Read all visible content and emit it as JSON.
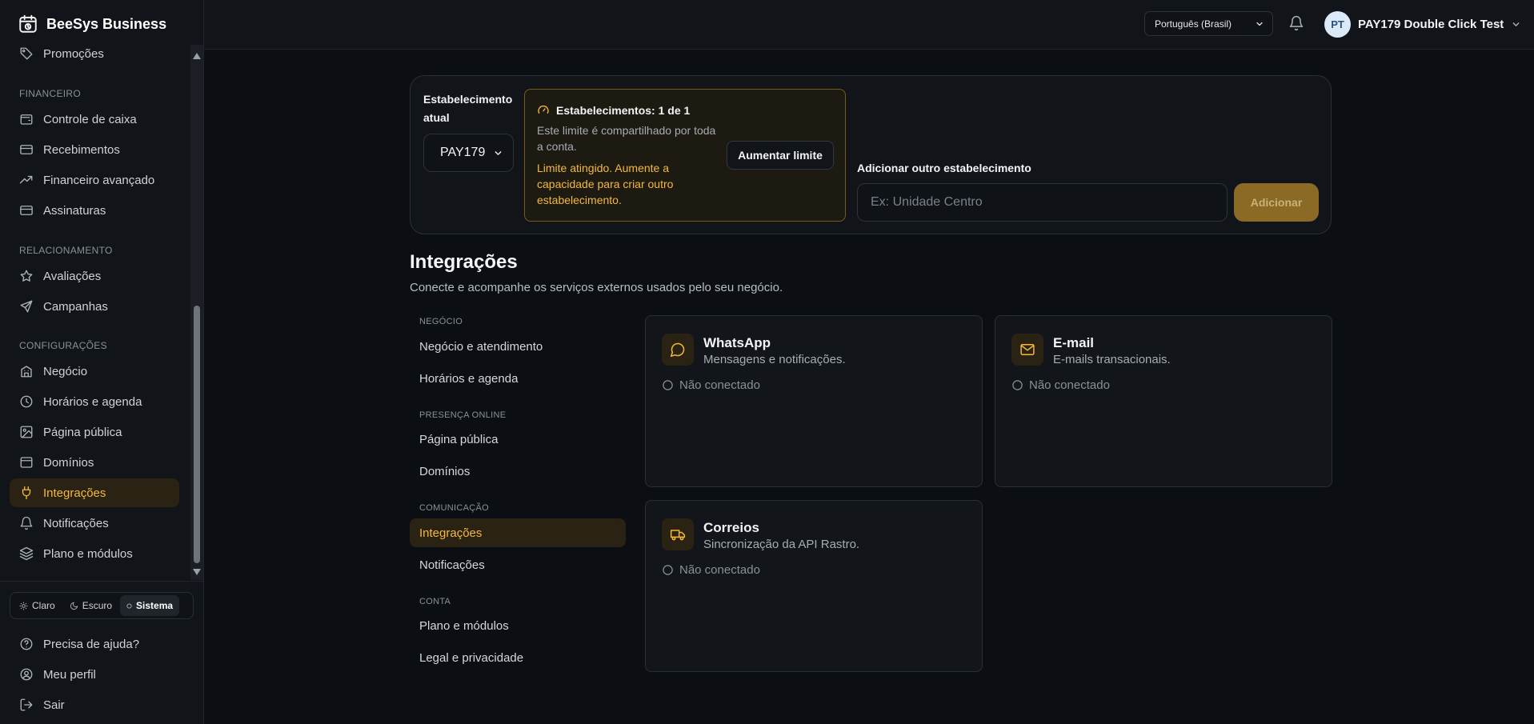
{
  "app": {
    "name": "BeeSys Business"
  },
  "sidebar": {
    "partial_top_item": "Promoções",
    "sections": [
      {
        "title": "FINANCEIRO",
        "items": [
          {
            "label": "Controle de caixa",
            "icon": "wallet-icon"
          },
          {
            "label": "Recebimentos",
            "icon": "credit-card-icon"
          },
          {
            "label": "Financeiro avançado",
            "icon": "trending-up-icon"
          },
          {
            "label": "Assinaturas",
            "icon": "credit-card-icon"
          }
        ]
      },
      {
        "title": "RELACIONAMENTO",
        "items": [
          {
            "label": "Avaliações",
            "icon": "star-icon"
          },
          {
            "label": "Campanhas",
            "icon": "send-icon"
          }
        ]
      },
      {
        "title": "CONFIGURAÇÕES",
        "items": [
          {
            "label": "Negócio",
            "icon": "building-icon"
          },
          {
            "label": "Horários e agenda",
            "icon": "clock-icon"
          },
          {
            "label": "Página pública",
            "icon": "image-icon"
          },
          {
            "label": "Domínios",
            "icon": "globe-icon"
          },
          {
            "label": "Integrações",
            "icon": "plug-icon",
            "active": true
          },
          {
            "label": "Notificações",
            "icon": "bell-icon"
          },
          {
            "label": "Plano e módulos",
            "icon": "layers-icon"
          }
        ]
      }
    ],
    "theme": {
      "options": [
        {
          "label": "Claro",
          "icon": "sun-icon"
        },
        {
          "label": "Escuro",
          "icon": "moon-icon"
        },
        {
          "label": "Sistema",
          "icon": "system-icon",
          "selected": true
        }
      ]
    },
    "bottom": [
      {
        "label": "Precisa de ajuda?",
        "icon": "help-icon"
      },
      {
        "label": "Meu perfil",
        "icon": "user-icon"
      },
      {
        "label": "Sair",
        "icon": "logout-icon"
      }
    ]
  },
  "topbar": {
    "language": "Português (Brasil)",
    "user": {
      "initials": "PT",
      "name": "PAY179 Double Click Test"
    }
  },
  "establishment": {
    "current_label": "Estabelecimento atual",
    "current_value": "PAY179",
    "limit_title": "Estabelecimentos: 1 de 1",
    "limit_desc": "Este limite é compartilhado por toda a conta.",
    "limit_warning": "Limite atingido. Aumente a capacidade para criar outro estabelecimento.",
    "raise_button": "Aumentar limite",
    "add_label": "Adicionar outro estabelecimento",
    "add_placeholder": "Ex: Unidade Centro",
    "add_button": "Adicionar"
  },
  "page": {
    "title": "Integrações",
    "subtitle": "Conecte e acompanhe os serviços externos usados pelo seu negócio."
  },
  "subnav": {
    "sections": [
      {
        "title": "NEGÓCIO",
        "items": [
          "Negócio e atendimento",
          "Horários e agenda"
        ]
      },
      {
        "title": "PRESENÇA ONLINE",
        "items": [
          "Página pública",
          "Domínios"
        ]
      },
      {
        "title": "COMUNICAÇÃO",
        "items": [
          "Integrações",
          "Notificações"
        ]
      },
      {
        "title": "CONTA",
        "items": [
          "Plano e módulos",
          "Legal e privacidade"
        ]
      }
    ],
    "active": "Integrações"
  },
  "integrations": [
    {
      "name": "WhatsApp",
      "desc": "Mensagens e notificações.",
      "status": "Não conectado",
      "icon": "chat-icon"
    },
    {
      "name": "E-mail",
      "desc": "E-mails transacionais.",
      "status": "Não conectado",
      "icon": "mail-icon"
    },
    {
      "name": "Correios",
      "desc": "Sincronização da API Rastro.",
      "status": "Não conectado",
      "icon": "truck-icon"
    }
  ],
  "colors": {
    "accent": "#f5b83d",
    "background": "#0b0e13",
    "panel": "#111418"
  }
}
